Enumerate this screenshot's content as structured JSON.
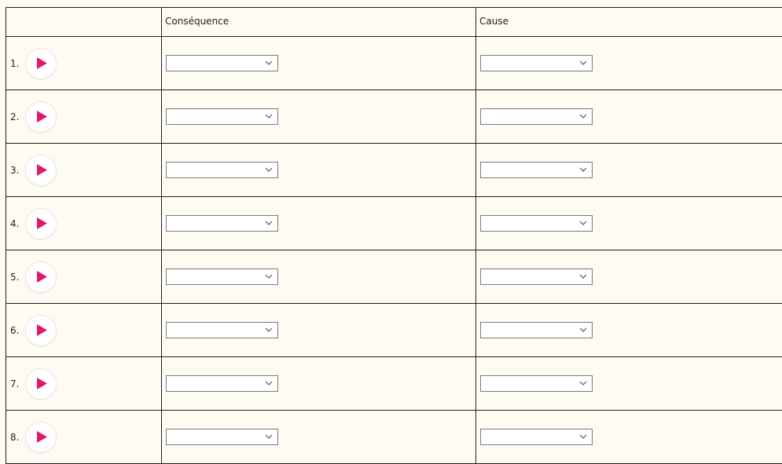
{
  "table": {
    "headers": [
      "",
      "Conséquence",
      "Cause"
    ],
    "rows": [
      {
        "number": "1.",
        "consequence": "",
        "cause": ""
      },
      {
        "number": "2.",
        "consequence": "",
        "cause": ""
      },
      {
        "number": "3.",
        "consequence": "",
        "cause": ""
      },
      {
        "number": "4.",
        "consequence": "",
        "cause": ""
      },
      {
        "number": "5.",
        "consequence": "",
        "cause": ""
      },
      {
        "number": "6.",
        "consequence": "",
        "cause": ""
      },
      {
        "number": "7.",
        "consequence": "",
        "cause": ""
      },
      {
        "number": "8.",
        "consequence": "",
        "cause": ""
      }
    ]
  },
  "icons": {
    "play": "play-icon",
    "dropdown": "chevron-down-icon"
  },
  "colors": {
    "accent": "#e5156c",
    "background": "#fefbf3",
    "border": "#1f1f1f"
  }
}
